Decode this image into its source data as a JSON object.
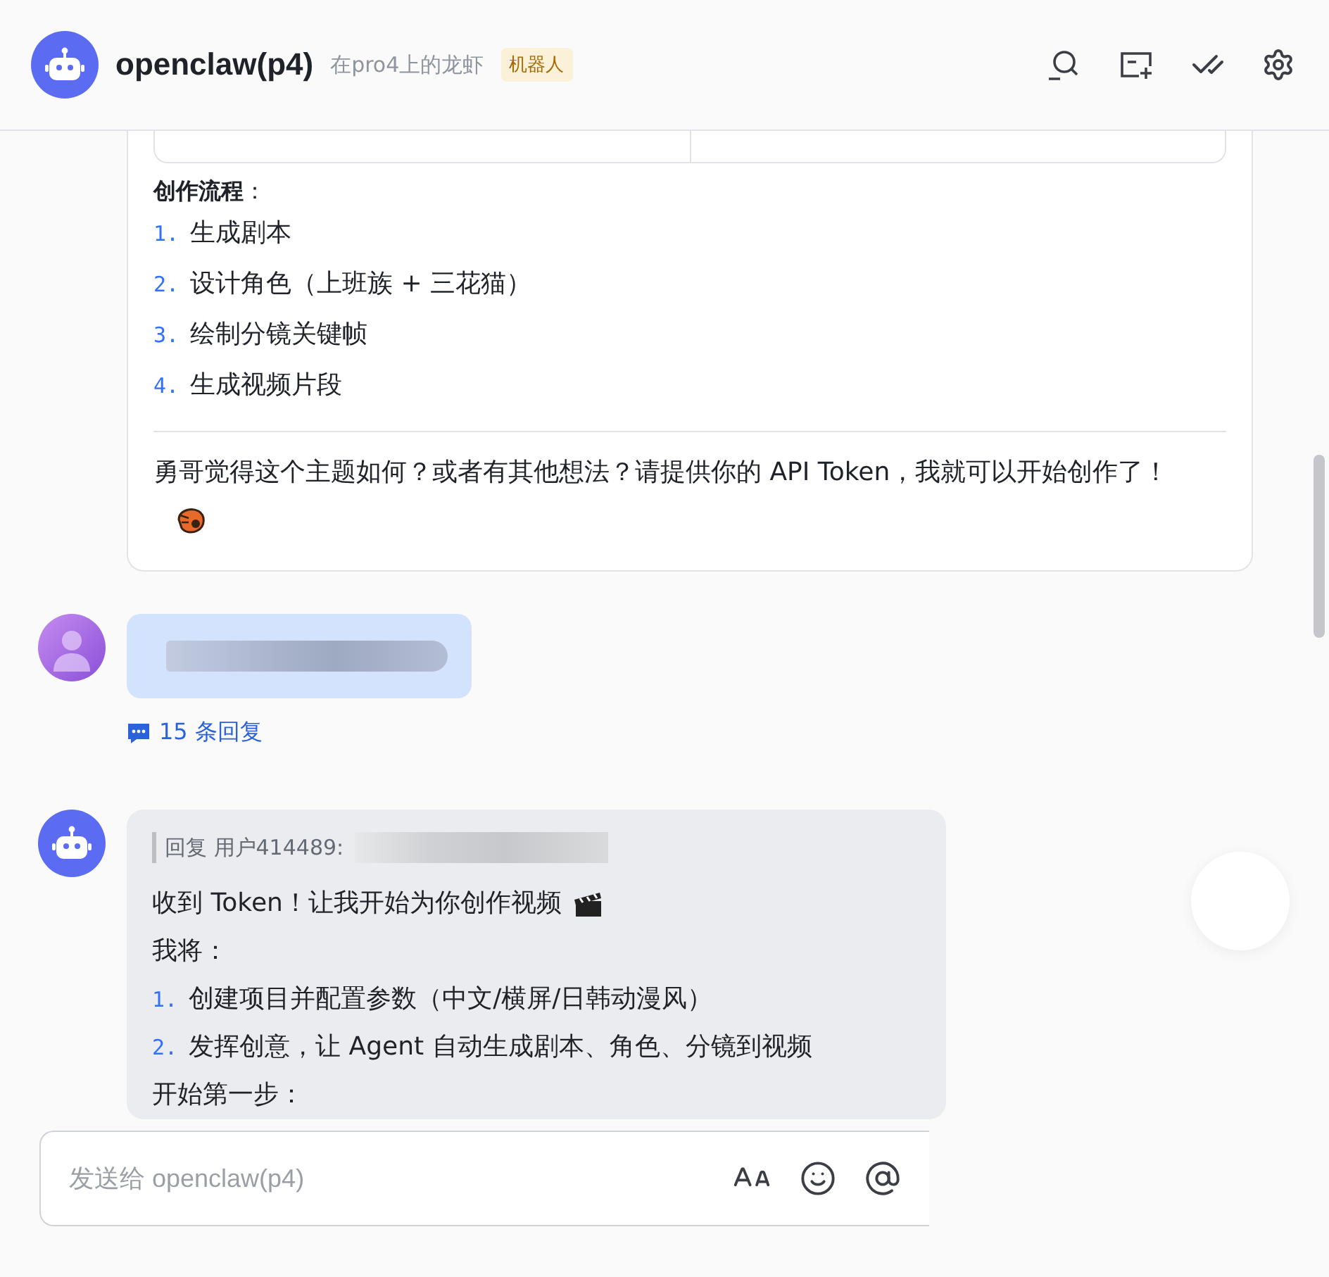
{
  "header": {
    "title": "openclaw(p4)",
    "subtitle": "在pro4上的龙虾",
    "badge": "机器人"
  },
  "top_card": {
    "heading": "**创作流程**：",
    "steps": [
      {
        "number": "1.",
        "text": "生成剧本"
      },
      {
        "number": "2.",
        "text": "设计角色（上班族 + 三花猫）"
      },
      {
        "number": "3.",
        "text": "绘制分镜关键帧"
      },
      {
        "number": "4.",
        "text": "生成视频片段"
      }
    ],
    "closing": "勇哥觉得这个主题如何？或者有其他想法？请提供你的 API Token，我就可以开始创作了！"
  },
  "user_message": {
    "reply_count": "15 条回复"
  },
  "bot_reply": {
    "quote": "回复 用户414489:",
    "first_line": "收到 Token！让我开始为你创作视频",
    "second_line": "我将：",
    "steps": [
      {
        "number": "1.",
        "text": "创建项目并配置参数（中文/横屏/日韩动漫风）"
      },
      {
        "number": "2.",
        "text": "发挥创意，让 Agent 自动生成剧本、角色、分镜到视频"
      }
    ],
    "last_line": "开始第一步："
  },
  "composer": {
    "placeholder": "发送给 openclaw(p4)"
  }
}
